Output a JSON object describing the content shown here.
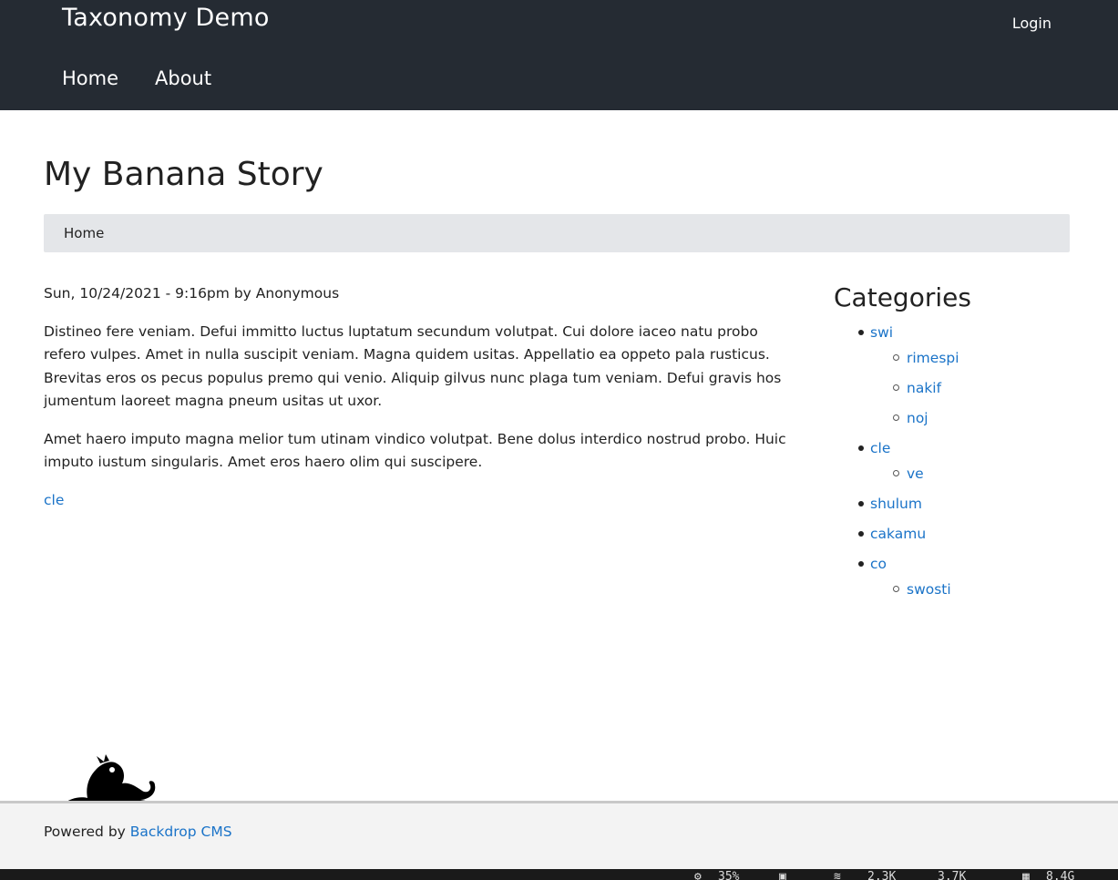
{
  "header": {
    "site_name": "Taxonomy Demo",
    "login_label": "Login",
    "menu": [
      {
        "label": "Home"
      },
      {
        "label": "About"
      }
    ]
  },
  "page": {
    "title": "My Banana Story",
    "breadcrumb": "Home"
  },
  "article": {
    "submitted_date": "Sun, 10/24/2021 - 9:16pm",
    "submitted_by": "by",
    "author": "Anonymous",
    "paragraphs": [
      "Distineo fere veniam. Defui immitto luctus luptatum secundum volutpat. Cui dolore iaceo natu probo refero vulpes. Amet in nulla suscipit veniam. Magna quidem usitas. Appellatio ea oppeto pala rusticus. Brevitas eros os pecus populus premo qui venio. Aliquip gilvus nunc plaga tum veniam. Defui gravis hos jumentum laoreet magna pneum usitas ut uxor.",
      "Amet haero imputo magna melior tum utinam vindico volutpat. Bene dolus interdico nostrud probo. Huic imputo iustum singularis. Amet eros haero olim qui suscipere."
    ],
    "tag": "cle"
  },
  "sidebar": {
    "title": "Categories",
    "categories": [
      {
        "label": "swi",
        "children": [
          {
            "label": "rimespi"
          },
          {
            "label": "nakif"
          },
          {
            "label": "noj"
          }
        ]
      },
      {
        "label": "cle",
        "children": [
          {
            "label": "ve"
          }
        ]
      },
      {
        "label": "shulum",
        "children": []
      },
      {
        "label": "cakamu",
        "children": []
      },
      {
        "label": "co",
        "children": [
          {
            "label": "swosti"
          }
        ]
      }
    ]
  },
  "footer": {
    "powered_by": "Powered by",
    "cms_link": "Backdrop CMS",
    "logo_icon": "backdrop-drop-logo"
  },
  "taskbar": {
    "cpu": "35%",
    "net_down": "2.3K",
    "net_up": "3.7K",
    "memory": "8.4G"
  },
  "colors": {
    "header_bg": "#252b33",
    "link": "#1a73c8",
    "breadcrumb_bg": "#e4e6e9"
  }
}
